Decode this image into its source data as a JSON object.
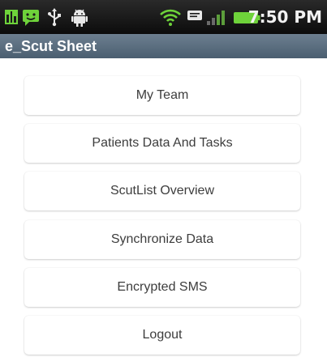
{
  "status_bar": {
    "time": "7:50 PM",
    "icons": [
      "device-icon",
      "android-chat-icon",
      "usb-icon",
      "android-robot-icon",
      "wifi-icon",
      "sms-icon",
      "signal-icon",
      "battery-icon"
    ],
    "colors": {
      "green": "#6ed23a",
      "gray": "#6a6a6a"
    }
  },
  "app": {
    "title": "e_Scut Sheet",
    "title_bar_color": "#56697b"
  },
  "menu": {
    "items": [
      {
        "label": "My Team"
      },
      {
        "label": "Patients Data And Tasks"
      },
      {
        "label": "ScutList Overview"
      },
      {
        "label": "Synchronize Data"
      },
      {
        "label": "Encrypted SMS"
      },
      {
        "label": "Logout"
      }
    ]
  }
}
